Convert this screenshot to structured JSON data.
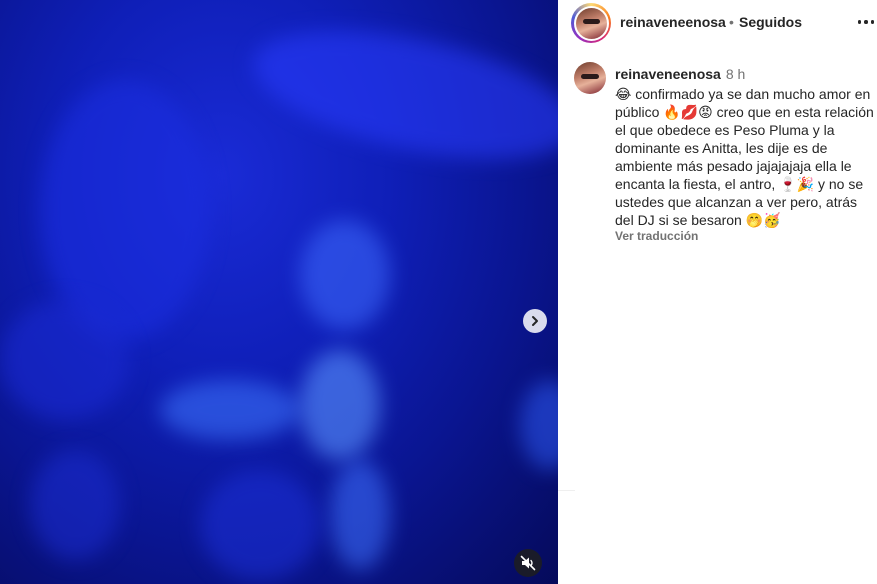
{
  "media": {
    "next_icon": "chevron-right-icon",
    "mute_icon": "speaker-muted-icon"
  },
  "header": {
    "username": "reinaveneenosa",
    "separator": "•",
    "follow_status": "Seguidos",
    "more_icon": "more-options-icon"
  },
  "caption": {
    "username": "reinaveneenosa",
    "time": "8 h",
    "text": "😂 confirmado ya se dan mucho amor en público 🔥💋😡 creo que en esta relación el que obedece es Peso Pluma y la dominante es Anitta, les dije es de ambiente más pesado jajajajaja ella le encanta la fiesta, el antro, 🍷🎉 y no se ustedes que alcanzan a ver pero, atrás del DJ si se besaron 🤭🥳",
    "translate_label": "Ver traducción"
  }
}
